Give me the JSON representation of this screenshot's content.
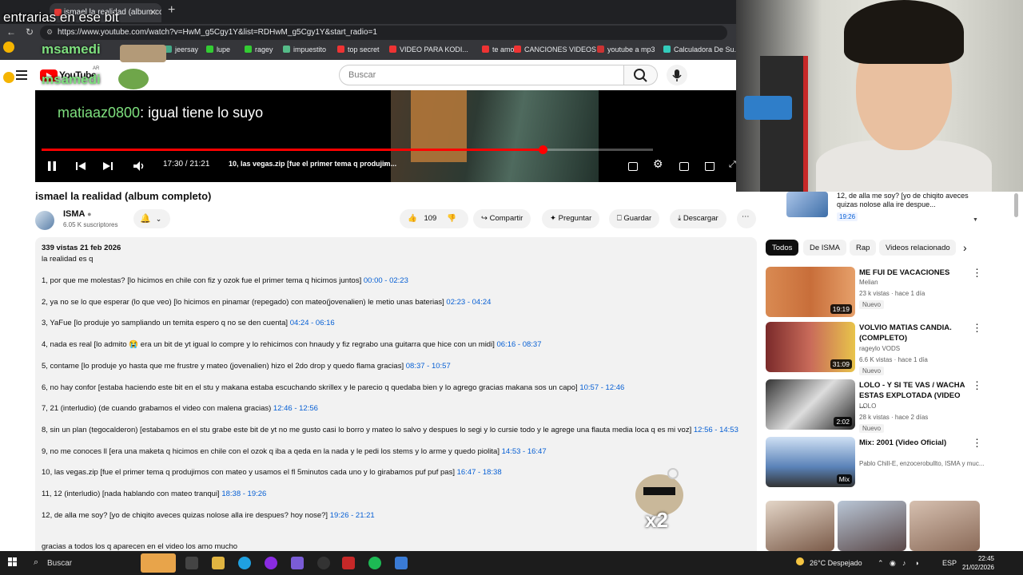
{
  "browser": {
    "tab_title": "ismael la realidad (album co...",
    "url": "https://www.youtube.com/watch?v=HwM_g5Cgy1Y&list=RDHwM_g5Cgy1Y&start_radio=1",
    "bookmarks": [
      {
        "label": "jeersay",
        "color": "#4a8"
      },
      {
        "label": "lupe",
        "color": "#3c3"
      },
      {
        "label": "ragey",
        "color": "#3c3"
      },
      {
        "label": "impuestito",
        "color": "#5b8"
      },
      {
        "label": "top secret",
        "color": "#e33"
      },
      {
        "label": "VIDEO PARA KODI...",
        "color": "#e33"
      },
      {
        "label": "te amo",
        "color": "#e33"
      },
      {
        "label": "CANCIONES VIDEOS",
        "color": "#e33"
      },
      {
        "label": "youtube a mp3",
        "color": "#c33"
      },
      {
        "label": "Calculadora De Su...",
        "color": "#3cb"
      }
    ]
  },
  "youtube": {
    "logo_text": "YouTube",
    "logo_region": "AR",
    "search_placeholder": "Buscar"
  },
  "player": {
    "time": "17:30 / 21:21",
    "chapter": "10, las vegas.zip [fue el primer tema q produjim...",
    "progress_fraction": 0.82
  },
  "overlays": {
    "top_text": "entrarias en ese bit",
    "user1": "msamedi",
    "user2": "msamedi",
    "chat_user": "matiaaz0800",
    "chat_text": ": igual tiene lo suyo"
  },
  "video": {
    "title": "ismael la realidad (album completo)",
    "channel": "ISMA",
    "subscribers": "6.05 K suscriptores",
    "likes": "109",
    "share": "Compartir",
    "ask": "Preguntar",
    "save": "Guardar",
    "download": "Descargar"
  },
  "description": {
    "meta": "339 vistas  21 feb 2026",
    "intro": "la realidad es q",
    "tracks": [
      {
        "text": "1, por que me molestas? [lo hicimos en chile con fiz y ozok fue el primer tema q hicimos juntos]",
        "ts": "00:00 - 02:23"
      },
      {
        "text": "2, ya no se lo que esperar (lo que veo) [lo hicimos en pinamar (repegado) con mateo(jovenalien) le metio unas baterias]",
        "ts": "02:23 - 04:24"
      },
      {
        "text": "3, YaFue [lo produje yo sampliando un temita espero q no se den cuenta]",
        "ts": "04:24 - 06:16"
      },
      {
        "text": "4, nada es real [lo admito 😭 era un bit de yt igual lo compre y lo rehicimos con hnaudy y fiz regrabo una guitarra que hice con un midi]",
        "ts": "06:16 - 08:37"
      },
      {
        "text": "5, contame [lo produje yo hasta que me frustre y mateo (jovenalien) hizo el 2do drop y quedo flama gracias]",
        "ts": "08:37 - 10:57"
      },
      {
        "text": "6, no hay confor [estaba haciendo este bit en el stu y makana estaba escuchando skrillex y le parecio q quedaba bien y lo agrego gracias makana sos un capo]",
        "ts": "10:57 - 12:46"
      },
      {
        "text": "7, 21 (interludio) (de cuando grabamos el video con malena gracias)",
        "ts": "12:46 - 12:56"
      },
      {
        "text": "8, sin un plan (tegocalderon) [estabamos en el stu grabe este bit de yt no me gusto casi lo borro y mateo lo salvo y despues lo segi y lo cursie todo y le agrege una flauta media loca q es mi voz]",
        "ts": "12:56 - 14:53"
      },
      {
        "text": "9, no me conoces ll [era una maketa q hicimos en chile con el ozok q iba a qeda en la nada y le pedi los stems y lo arme y quedo piolita]",
        "ts": "14:53 - 16:47"
      },
      {
        "text": "10, las vegas.zip [fue el primer tema q produjimos con mateo y usamos el fl 5minutos cada uno y lo girabamos puf puf pas]",
        "ts": "16:47 - 18:38"
      },
      {
        "text": "11, 12 (interludio) [nada hablando con mateo tranqui]",
        "ts": "18:38 - 19:26"
      },
      {
        "text": "12, de alla me soy? [yo de chiqito aveces quizas nolose alla ire despues? hoy nose?]",
        "ts": "19:26 - 21:21"
      }
    ],
    "outro": "gracias a todos los q aparecen en el video los amo mucho"
  },
  "up_next": {
    "title": "12, de alla me soy? [yo de chiqito aveces quizas nolose alla ire despue...",
    "timestamp": "19:26"
  },
  "chips": [
    "Todos",
    "De ISMA",
    "Rap",
    "Videos relacionado"
  ],
  "recommendations": [
    {
      "title": "ME FUI DE VACACIONES",
      "channel": "Melian",
      "stats": "23 k vistas · hace 1 día",
      "badge": "Nuevo",
      "duration": "19:19"
    },
    {
      "title": "VOLVIO MATIAS CANDIA. (COMPLETO)",
      "channel": "rageylo VODS",
      "stats": "6.6 K vistas · hace 1 día",
      "badge": "Nuevo",
      "duration": "31:09"
    },
    {
      "title": "LOLO - Y SI TE VAS / WACHA ESTAS EXPLOTADA (VIDEO ...",
      "channel": "LOLO",
      "stats": "28 k vistas · hace 2 días",
      "badge": "Nuevo",
      "duration": "2:02"
    },
    {
      "title": "Mix: 2001 (Video Oficial)",
      "channel": "Pablo Chill-E, enzocerobullto, ISMA y muc...",
      "stats": "",
      "badge": "",
      "duration": "Mix"
    }
  ],
  "taskbar": {
    "search": "Buscar",
    "weather": "26°C  Despejado",
    "lang": "ESP",
    "time": "22:45",
    "date": "21/02/2026"
  },
  "sticker_text": "x2"
}
